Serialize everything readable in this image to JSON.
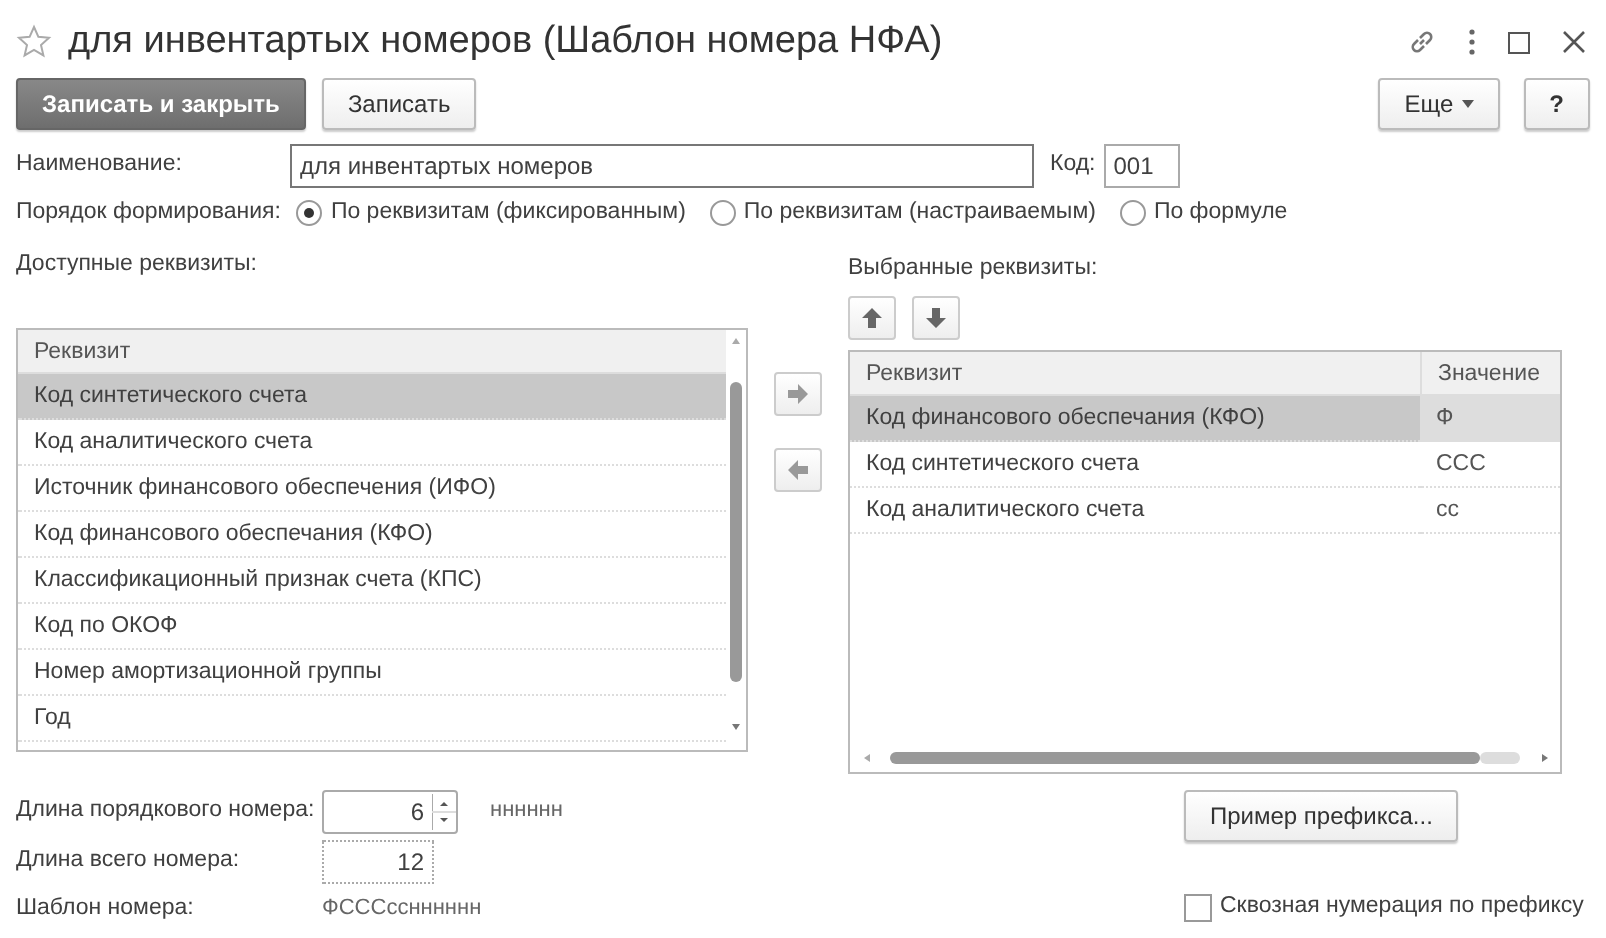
{
  "window": {
    "title": "для инвентартых номеров (Шаблон номера НФА)"
  },
  "toolbar": {
    "buttons": [
      {
        "label": "Записать и закрыть",
        "kind": "primary"
      },
      {
        "label": "Записать",
        "kind": "default"
      }
    ],
    "more": "Еще",
    "help": "?"
  },
  "name_field": {
    "label": "Наименование:",
    "value": "для инвентартых номеров"
  },
  "code_field": {
    "label": "Код:",
    "value": "001"
  },
  "order": {
    "label": "Порядок формирования:",
    "options": [
      {
        "label": "По реквизитам (фиксированным)",
        "selected": true
      },
      {
        "label": "По реквизитам (настраиваемым)",
        "selected": false
      },
      {
        "label": "По формуле",
        "selected": false
      }
    ]
  },
  "available": {
    "label": "Доступные реквизиты:",
    "column": "Реквизит",
    "rows": [
      {
        "text": "Код синтетического счета",
        "selected": true
      },
      {
        "text": "Код аналитического счета",
        "selected": false
      },
      {
        "text": "Источник финансового обеспечения (ИФО)",
        "selected": false
      },
      {
        "text": "Код финансового обеспечания (КФО)",
        "selected": false
      },
      {
        "text": "Классификационный признак счета (КПС)",
        "selected": false
      },
      {
        "text": "Код по ОКОФ",
        "selected": false
      },
      {
        "text": "Номер амортизационной группы",
        "selected": false
      },
      {
        "text": "Год",
        "selected": false
      }
    ]
  },
  "chosen": {
    "label": "Выбранные реквизиты:",
    "columns": [
      "Реквизит",
      "Значение"
    ],
    "rows": [
      {
        "name": "Код финансового обеспечания (КФО)",
        "value": "Ф",
        "selected": true
      },
      {
        "name": "Код синтетического счета",
        "value": "ССС",
        "selected": false
      },
      {
        "name": "Код аналитического счета",
        "value": "сс",
        "selected": false
      }
    ]
  },
  "serial_length": {
    "label": "Длина порядкового номера:",
    "value": "6",
    "hint": "нннннн"
  },
  "total_length": {
    "label": "Длина всего номера:",
    "value": "12"
  },
  "template": {
    "label": "Шаблон номера:",
    "value": "ФСССсснннннн"
  },
  "prefix_button": "Пример префикса...",
  "through_numbering": {
    "label": "Сквозная нумерация по префиксу",
    "checked": false
  }
}
